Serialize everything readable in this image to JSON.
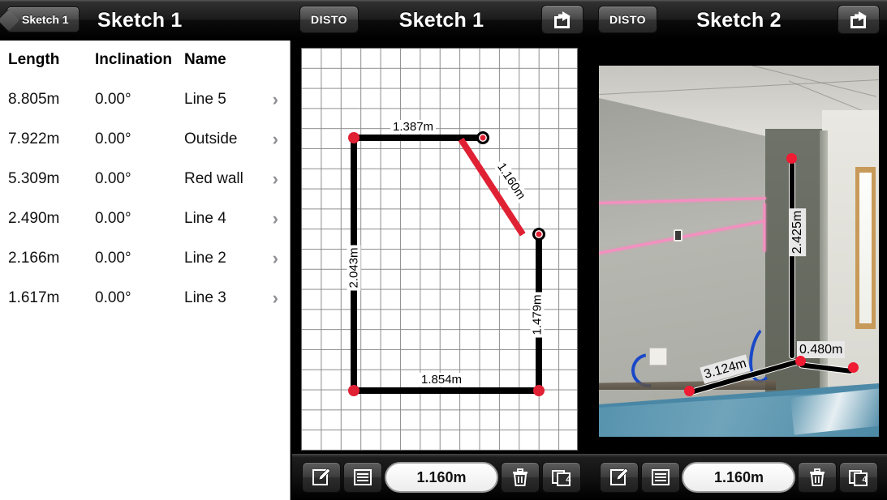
{
  "panel1": {
    "nav": {
      "back_label": "Sketch 1",
      "title": "Sketch 1"
    },
    "table": {
      "headers": {
        "length": "Length",
        "inclination": "Inclination",
        "name": "Name"
      },
      "rows": [
        {
          "length": "8.805m",
          "inclination": "0.00°",
          "name": "Line 5",
          "chevron": "›"
        },
        {
          "length": "7.922m",
          "inclination": "0.00°",
          "name": "Outside",
          "chevron": "›"
        },
        {
          "length": "5.309m",
          "inclination": "0.00°",
          "name": "Red wall",
          "chevron": "›"
        },
        {
          "length": "2.490m",
          "inclination": "0.00°",
          "name": "Line 4",
          "chevron": "›"
        },
        {
          "length": "2.166m",
          "inclination": "0.00°",
          "name": "Line 2",
          "chevron": "›"
        },
        {
          "length": "1.617m",
          "inclination": "0.00°",
          "name": "Line 3",
          "chevron": "›"
        }
      ]
    }
  },
  "panel2": {
    "nav": {
      "disto_label": "DISTO",
      "title": "Sketch 1",
      "share_icon": "share-icon"
    },
    "sketch": {
      "dimensions": {
        "top": "1.387m",
        "diagonal": "1.160m",
        "left": "2.043m",
        "right": "1.479m",
        "bottom": "1.854m"
      },
      "selected_color": "#e02134",
      "line_color": "#000000",
      "node_color": "#e02134"
    },
    "toolbar": {
      "edit_icon": "edit-pencil-icon",
      "list_icon": "list-icon",
      "value": "1.160m",
      "delete_icon": "trash-icon",
      "layers_icon": "layers-icon",
      "layers_count": "4"
    }
  },
  "panel3": {
    "nav": {
      "disto_label": "DISTO",
      "title": "Sketch 2",
      "share_icon": "share-icon"
    },
    "photo": {
      "measurements": {
        "vertical": "2.425m",
        "short": "0.480m",
        "diagonal": "3.124m"
      },
      "laser_color": "#f58ec0",
      "node_color": "#ef1c34"
    },
    "toolbar": {
      "edit_icon": "edit-pencil-icon",
      "list_icon": "list-icon",
      "value": "1.160m",
      "delete_icon": "trash-icon",
      "layers_icon": "layers-icon",
      "layers_count": "4"
    }
  }
}
